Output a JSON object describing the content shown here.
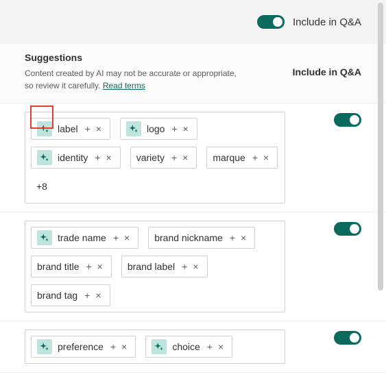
{
  "topbar": {
    "toggle_on": true,
    "toggle_label": "Include in Q&A"
  },
  "header": {
    "title": "Suggestions",
    "subtitle_prefix": "Content created by AI may not be accurate or appropriate, so review it carefully. ",
    "read_terms": "Read terms",
    "col_label": "Include in Q&A"
  },
  "groups": [
    {
      "toggle_on": true,
      "more": "+8",
      "items": [
        {
          "label": "label",
          "ai": true
        },
        {
          "label": "logo",
          "ai": true
        },
        {
          "label": "identity",
          "ai": true
        },
        {
          "label": "variety",
          "ai": false
        },
        {
          "label": "marque",
          "ai": false
        }
      ]
    },
    {
      "toggle_on": true,
      "more": null,
      "items": [
        {
          "label": "trade name",
          "ai": true
        },
        {
          "label": "brand nickname",
          "ai": false
        },
        {
          "label": "brand title",
          "ai": false
        },
        {
          "label": "brand label",
          "ai": false
        },
        {
          "label": "brand tag",
          "ai": false
        }
      ]
    },
    {
      "toggle_on": true,
      "more": null,
      "items": [
        {
          "label": "preference",
          "ai": true
        },
        {
          "label": "choice",
          "ai": true
        }
      ]
    }
  ],
  "glyphs": {
    "add": "+",
    "remove": "×"
  },
  "colors": {
    "accent": "#0b6a5e",
    "ai_bg": "#bfe3dd",
    "highlight": "#e83a2a"
  }
}
